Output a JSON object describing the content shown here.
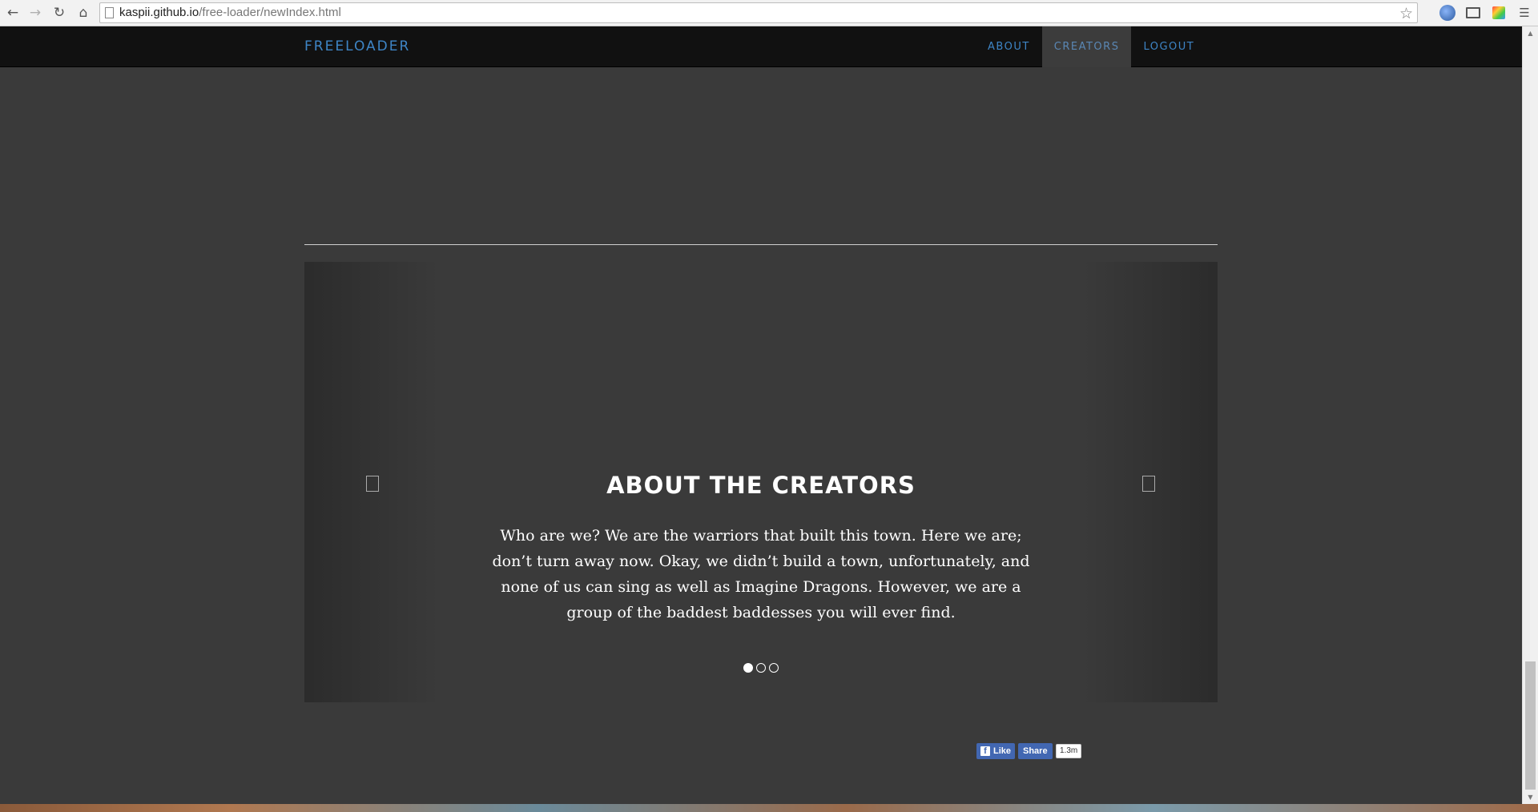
{
  "browser": {
    "url_host": "kaspii.github.io",
    "url_path": "/free-loader/newIndex.html"
  },
  "site_nav": {
    "brand": "FREELOADER",
    "links": [
      {
        "label": "ABOUT",
        "active": false
      },
      {
        "label": "CREATORS",
        "active": true
      },
      {
        "label": "LOGOUT",
        "active": false
      }
    ]
  },
  "carousel": {
    "title": "ABOUT THE CREATORS",
    "text": "Who are we? We are the warriors that built this town. Here we are; don’t turn away now. Okay, we didn’t build a town, unfortunately, and none of us can sing as well as Imagine Dragons. However, we are a group of the baddest baddesses you will ever find.",
    "slide_count": 3,
    "active_slide": 1
  },
  "facebook": {
    "like_label": "Like",
    "share_label": "Share",
    "count": "1.3m"
  },
  "colors": {
    "accent": "#3e85c6",
    "nav_bg": "#111111",
    "page_bg": "#3a3a3a",
    "fb_blue": "#4267b2"
  },
  "icons": [
    "back-icon",
    "forward-icon",
    "reload-icon",
    "home-icon",
    "page-icon",
    "star-icon",
    "globe-icon",
    "cast-icon",
    "color-picker-icon",
    "menu-icon",
    "prev-icon",
    "next-icon",
    "facebook-icon"
  ]
}
